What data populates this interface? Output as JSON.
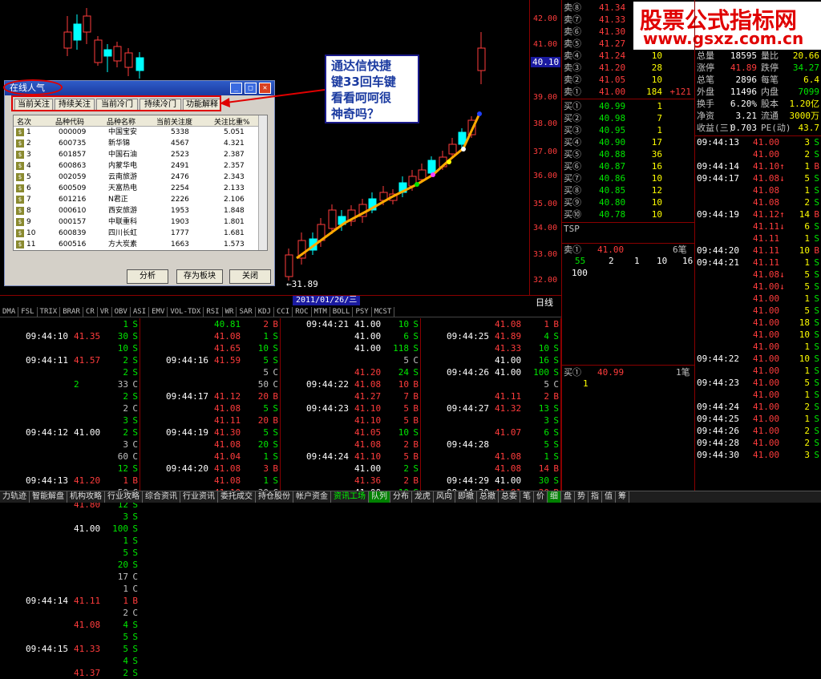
{
  "logo": {
    "line1": "股票公式指标网",
    "line2": "www.gsxz.com.cn"
  },
  "chart": {
    "price_labels": [
      "42.00",
      "41.00",
      "40.10",
      "39.00",
      "38.00",
      "37.00",
      "36.00",
      "35.00",
      "34.00",
      "33.00",
      "32.00"
    ],
    "current_price_label": "40.10",
    "low_marker": "←31.89",
    "date": "2011/01/26/三",
    "period": "日线",
    "indicators": [
      "DMA",
      "FSL",
      "TRIX",
      "BRAR",
      "CR",
      "VR",
      "OBV",
      "ASI",
      "EMV",
      "VOL-TDX",
      "RSI",
      "WR",
      "SAR",
      "KDJ",
      "CCI",
      "ROC",
      "MTM",
      "BOLL",
      "PSY",
      "MCST"
    ]
  },
  "callout": {
    "lines": [
      "通达信快捷",
      "键33回车键",
      "看看呵呵很",
      "神奇吗？"
    ]
  },
  "dialog": {
    "title": "在线人气",
    "tabs": [
      "当前关注",
      "持续关注",
      "当前冷门",
      "持续冷门",
      "功能解释"
    ],
    "headers": [
      "名次",
      "品种代码",
      "品种名称",
      "当前关注度",
      "关注比重%"
    ],
    "rows": [
      {
        "rank": "1",
        "code": "000009",
        "name": "中国宝安",
        "score": "5338",
        "pct": "5.051"
      },
      {
        "rank": "2",
        "code": "600735",
        "name": "新华锦",
        "score": "4567",
        "pct": "4.321"
      },
      {
        "rank": "3",
        "code": "601857",
        "name": "中国石油",
        "score": "2523",
        "pct": "2.387"
      },
      {
        "rank": "4",
        "code": "600863",
        "name": "内蒙华电",
        "score": "2491",
        "pct": "2.357"
      },
      {
        "rank": "5",
        "code": "002059",
        "name": "云南旅游",
        "score": "2476",
        "pct": "2.343"
      },
      {
        "rank": "6",
        "code": "600509",
        "name": "天富热电",
        "score": "2254",
        "pct": "2.133"
      },
      {
        "rank": "7",
        "code": "601216",
        "name": "N君正",
        "score": "2226",
        "pct": "2.106"
      },
      {
        "rank": "8",
        "code": "000610",
        "name": "西安旅游",
        "score": "1953",
        "pct": "1.848"
      },
      {
        "rank": "9",
        "code": "000157",
        "name": "中联重科",
        "score": "1903",
        "pct": "1.801"
      },
      {
        "rank": "10",
        "code": "600839",
        "name": "四川长虹",
        "score": "1777",
        "pct": "1.681"
      },
      {
        "rank": "11",
        "code": "600516",
        "name": "方大炭素",
        "score": "1663",
        "pct": "1.573"
      }
    ],
    "buttons": [
      "分析",
      "存为板块",
      "关闭"
    ]
  },
  "asks": [
    {
      "l": "卖⑧",
      "p": "41.34",
      "v": "",
      "x": ""
    },
    {
      "l": "卖⑦",
      "p": "41.33",
      "v": "",
      "x": ""
    },
    {
      "l": "卖⑥",
      "p": "41.30",
      "v": "",
      "x": ""
    },
    {
      "l": "卖⑤",
      "p": "41.27",
      "v": "",
      "x": ""
    },
    {
      "l": "卖④",
      "p": "41.24",
      "v": "10",
      "x": ""
    },
    {
      "l": "卖③",
      "p": "41.20",
      "v": "28",
      "x": ""
    },
    {
      "l": "卖②",
      "p": "41.05",
      "v": "10",
      "x": ""
    },
    {
      "l": "卖①",
      "p": "41.00",
      "v": "184",
      "x": "+121"
    }
  ],
  "bids": [
    {
      "l": "买①",
      "p": "40.99",
      "v": "1"
    },
    {
      "l": "买②",
      "p": "40.98",
      "v": "7"
    },
    {
      "l": "买③",
      "p": "40.95",
      "v": "1"
    },
    {
      "l": "买④",
      "p": "40.90",
      "v": "17"
    },
    {
      "l": "买⑤",
      "p": "40.88",
      "v": "36"
    },
    {
      "l": "买⑥",
      "p": "40.87",
      "v": "16"
    },
    {
      "l": "买⑦",
      "p": "40.86",
      "v": "10"
    },
    {
      "l": "买⑧",
      "p": "40.85",
      "v": "12"
    },
    {
      "l": "买⑨",
      "p": "40.80",
      "v": "10"
    },
    {
      "l": "买⑩",
      "p": "40.78",
      "v": "10"
    }
  ],
  "tsp": {
    "label": "TSP",
    "sell_label": "卖①",
    "sell_price": "41.00",
    "sell_count": "6笔",
    "queue": [
      "55",
      "2",
      "1",
      "10",
      "16",
      "100"
    ],
    "buy_label": "买①",
    "buy_price": "40.99",
    "buy_count": "1笔",
    "buy_queue": "1"
  },
  "stats": [
    {
      "a": "总量",
      "b": "18595",
      "c": "量比",
      "d": "20.66"
    },
    {
      "a": "涨停",
      "b": "41.89",
      "c": "跌停",
      "d": "34.27"
    },
    {
      "a": "总笔",
      "b": "2896",
      "c": "每笔",
      "d": "6.4"
    },
    {
      "a": "外盘",
      "b": "11496",
      "c": "内盘",
      "d": "7099"
    },
    {
      "a": "换手",
      "b": "6.20%",
      "c": "股本",
      "d": "1.20亿"
    },
    {
      "a": "净资",
      "b": "3.21",
      "c": "流通",
      "d": "3000万"
    },
    {
      "a": "收益(三)",
      "b": "0.703",
      "c": "PE(动)",
      "d": "43.7"
    }
  ],
  "ticks": [
    {
      "t": "09:44:13",
      "p": "41.00",
      "v": "3",
      "s": "S"
    },
    {
      "t": "",
      "p": "41.00",
      "v": "2",
      "s": "S"
    },
    {
      "t": "09:44:14",
      "p": "41.10↑",
      "v": "1",
      "s": "B"
    },
    {
      "t": "09:44:17",
      "p": "41.08↓",
      "v": "5",
      "s": "S"
    },
    {
      "t": "",
      "p": "41.08",
      "v": "1",
      "s": "S"
    },
    {
      "t": "",
      "p": "41.08",
      "v": "2",
      "s": "S"
    },
    {
      "t": "09:44:19",
      "p": "41.12↑",
      "v": "14",
      "s": "B"
    },
    {
      "t": "",
      "p": "41.11↓",
      "v": "6",
      "s": "S"
    },
    {
      "t": "",
      "p": "41.11",
      "v": "1",
      "s": "S"
    },
    {
      "t": "09:44:20",
      "p": "41.11",
      "v": "10",
      "s": "B"
    },
    {
      "t": "09:44:21",
      "p": "41.11",
      "v": "1",
      "s": "S"
    },
    {
      "t": "",
      "p": "41.08↓",
      "v": "5",
      "s": "S"
    },
    {
      "t": "",
      "p": "41.00↓",
      "v": "5",
      "s": "S"
    },
    {
      "t": "",
      "p": "41.00",
      "v": "1",
      "s": "S"
    },
    {
      "t": "",
      "p": "41.00",
      "v": "5",
      "s": "S"
    },
    {
      "t": "",
      "p": "41.00",
      "v": "18",
      "s": "S"
    },
    {
      "t": "",
      "p": "41.00",
      "v": "10",
      "s": "S"
    },
    {
      "t": "",
      "p": "41.00",
      "v": "1",
      "s": "S"
    },
    {
      "t": "09:44:22",
      "p": "41.00",
      "v": "10",
      "s": "S"
    },
    {
      "t": "",
      "p": "41.00",
      "v": "1",
      "s": "S"
    },
    {
      "t": "09:44:23",
      "p": "41.00",
      "v": "5",
      "s": "S"
    },
    {
      "t": "",
      "p": "41.00",
      "v": "1",
      "s": "S"
    },
    {
      "t": "09:44:24",
      "p": "41.00",
      "v": "2",
      "s": "S"
    },
    {
      "t": "09:44:25",
      "p": "41.00",
      "v": "1",
      "s": "S"
    },
    {
      "t": "09:44:26",
      "p": "41.00",
      "v": "2",
      "s": "S"
    },
    {
      "t": "09:44:28",
      "p": "41.00",
      "v": "2",
      "s": "S"
    },
    {
      "t": "09:44:30",
      "p": "41.00",
      "v": "3",
      "s": "S"
    }
  ],
  "trade_cols": [
    [
      {
        "t": "",
        "p": "",
        "v": "1",
        "s": "S"
      },
      {
        "t": "09:44:10",
        "p": "41.35",
        "v": "30",
        "s": "S"
      },
      {
        "t": "",
        "p": "",
        "v": "10",
        "s": "S"
      },
      {
        "t": "09:44:11",
        "p": "41.57",
        "v": "2",
        "s": "S"
      },
      {
        "t": "",
        "p": "",
        "v": "2",
        "s": "S"
      },
      {
        "t": "",
        "p": "2",
        "v": "33",
        "s": "C"
      },
      {
        "t": "",
        "p": "",
        "v": "2",
        "s": "S"
      },
      {
        "t": "",
        "p": "",
        "v": "2",
        "s": "C"
      },
      {
        "t": "",
        "p": "",
        "v": "3",
        "s": "S"
      },
      {
        "t": "09:44:12",
        "p": "41.00",
        "v": "2",
        "s": "S"
      },
      {
        "t": "",
        "p": "",
        "v": "3",
        "s": "C"
      },
      {
        "t": "",
        "p": "",
        "v": "60",
        "s": "C"
      },
      {
        "t": "",
        "p": "",
        "v": "12",
        "s": "S"
      },
      {
        "t": "09:44:13",
        "p": "41.20",
        "v": "1",
        "s": "B"
      },
      {
        "t": "",
        "p": "",
        "v": "50",
        "s": "C"
      },
      {
        "t": "",
        "p": "41.80",
        "v": "12",
        "s": "S"
      },
      {
        "t": "",
        "p": "",
        "v": "3",
        "s": "S"
      },
      {
        "t": "",
        "p": "41.00",
        "v": "100",
        "s": "S"
      },
      {
        "t": "",
        "p": "",
        "v": "1",
        "s": "S"
      },
      {
        "t": "",
        "p": "",
        "v": "5",
        "s": "S"
      },
      {
        "t": "",
        "p": "",
        "v": "20",
        "s": "S"
      },
      {
        "t": "",
        "p": "",
        "v": "17",
        "s": "C"
      },
      {
        "t": "",
        "p": "",
        "v": "1",
        "s": "C"
      },
      {
        "t": "09:44:14",
        "p": "41.11",
        "v": "1",
        "s": "B"
      },
      {
        "t": "",
        "p": "",
        "v": "2",
        "s": "C"
      },
      {
        "t": "",
        "p": "41.08",
        "v": "4",
        "s": "S"
      },
      {
        "t": "",
        "p": "",
        "v": "5",
        "s": "S"
      },
      {
        "t": "09:44:15",
        "p": "41.33",
        "v": "5",
        "s": "S"
      },
      {
        "t": "",
        "p": "",
        "v": "4",
        "s": "S"
      },
      {
        "t": "",
        "p": "41.37",
        "v": "2",
        "s": "S"
      }
    ],
    [
      {
        "t": "",
        "p": "40.81",
        "v": "2",
        "s": "B"
      },
      {
        "t": "",
        "p": "41.08",
        "v": "1",
        "s": "S"
      },
      {
        "t": "",
        "p": "41.65",
        "v": "10",
        "s": "S"
      },
      {
        "t": "09:44:16",
        "p": "41.59",
        "v": "5",
        "s": "S"
      },
      {
        "t": "",
        "p": "",
        "v": "5",
        "s": "C"
      },
      {
        "t": "",
        "p": "",
        "v": "50",
        "s": "C"
      },
      {
        "t": "09:44:17",
        "p": "41.12",
        "v": "20",
        "s": "B"
      },
      {
        "t": "",
        "p": "41.08",
        "v": "5",
        "s": "S"
      },
      {
        "t": "",
        "p": "41.11",
        "v": "20",
        "s": "B"
      },
      {
        "t": "09:44:19",
        "p": "41.30",
        "v": "5",
        "s": "S"
      },
      {
        "t": "",
        "p": "41.08",
        "v": "20",
        "s": "S"
      },
      {
        "t": "",
        "p": "41.04",
        "v": "1",
        "s": "S"
      },
      {
        "t": "09:44:20",
        "p": "41.08",
        "v": "3",
        "s": "B"
      },
      {
        "t": "",
        "p": "41.08",
        "v": "1",
        "s": "S"
      },
      {
        "t": "",
        "p": "41.10",
        "v": "30",
        "s": "C"
      }
    ],
    [
      {
        "t": "09:44:21",
        "p": "41.00",
        "v": "10",
        "s": "S"
      },
      {
        "t": "",
        "p": "41.00",
        "v": "6",
        "s": "S"
      },
      {
        "t": "",
        "p": "41.00",
        "v": "118",
        "s": "S"
      },
      {
        "t": "",
        "p": "",
        "v": "5",
        "s": "C"
      },
      {
        "t": "",
        "p": "41.20",
        "v": "24",
        "s": "S"
      },
      {
        "t": "09:44:22",
        "p": "41.08",
        "v": "10",
        "s": "B"
      },
      {
        "t": "",
        "p": "41.27",
        "v": "7",
        "s": "B"
      },
      {
        "t": "09:44:23",
        "p": "41.10",
        "v": "5",
        "s": "B"
      },
      {
        "t": "",
        "p": "41.10",
        "v": "5",
        "s": "B"
      },
      {
        "t": "",
        "p": "41.05",
        "v": "10",
        "s": "S"
      },
      {
        "t": "",
        "p": "41.08",
        "v": "2",
        "s": "B"
      },
      {
        "t": "09:44:24",
        "p": "41.10",
        "v": "5",
        "s": "B"
      },
      {
        "t": "",
        "p": "41.00",
        "v": "2",
        "s": "S"
      },
      {
        "t": "",
        "p": "41.36",
        "v": "2",
        "s": "B"
      },
      {
        "t": "",
        "p": "41.00",
        "v": "10",
        "s": "S"
      }
    ],
    [
      {
        "t": "",
        "p": "41.08",
        "v": "1",
        "s": "B"
      },
      {
        "t": "09:44:25",
        "p": "41.89",
        "v": "4",
        "s": "S"
      },
      {
        "t": "",
        "p": "41.33",
        "v": "10",
        "s": "S"
      },
      {
        "t": "",
        "p": "41.00",
        "v": "16",
        "s": "S"
      },
      {
        "t": "09:44:26",
        "p": "41.00",
        "v": "100",
        "s": "S"
      },
      {
        "t": "",
        "p": "",
        "v": "5",
        "s": "C"
      },
      {
        "t": "",
        "p": "41.11",
        "v": "2",
        "s": "B"
      },
      {
        "t": "09:44:27",
        "p": "41.32",
        "v": "13",
        "s": "S"
      },
      {
        "t": "",
        "p": "",
        "v": "3",
        "s": "S"
      },
      {
        "t": "",
        "p": "41.07",
        "v": "6",
        "s": "S"
      },
      {
        "t": "09:44:28",
        "p": "",
        "v": "5",
        "s": "S"
      },
      {
        "t": "",
        "p": "41.08",
        "v": "1",
        "s": "S"
      },
      {
        "t": "",
        "p": "41.08",
        "v": "14",
        "s": "B"
      },
      {
        "t": "09:44:29",
        "p": "41.00",
        "v": "30",
        "s": "S"
      },
      {
        "t": "09:44:30",
        "p": "41.01",
        "v": "20",
        "s": "B"
      }
    ]
  ],
  "bottom_tabs": [
    "力轨迹",
    "智能解盘",
    "机构攻略",
    "行业攻略",
    "综合资讯",
    "行业资讯",
    "委托成交",
    "持仓股份",
    "帐户资金",
    "资讯工场",
    "队列",
    "分布",
    "龙虎",
    "风向",
    "即撤",
    "总撤",
    "总委",
    "笔",
    "价",
    "细",
    "盘",
    "势",
    "指",
    "值",
    "筹"
  ]
}
